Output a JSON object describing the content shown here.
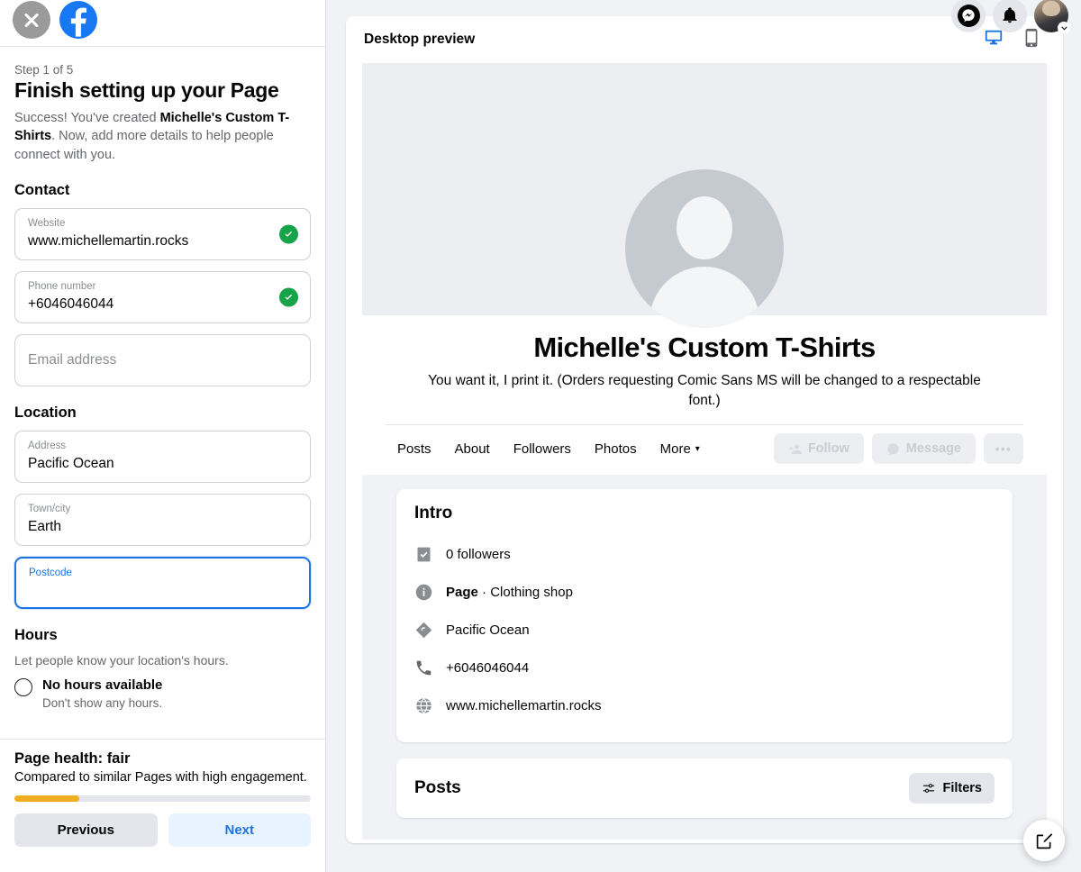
{
  "sidebar": {
    "close_icon": "close-icon",
    "brand_icon": "facebook-logo",
    "step_label": "Step 1 of 5",
    "title": "Finish setting up your Page",
    "desc_part1": "Success! You've created ",
    "desc_bold": "Michelle's Custom T-Shirts",
    "desc_part2": ". Now, add more details to help people connect with you.",
    "contact_heading": "Contact",
    "location_heading": "Location",
    "fields": {
      "website": {
        "label": "Website",
        "value": "www.michellemartin.rocks",
        "valid": true
      },
      "phone": {
        "label": "Phone number",
        "value": "+6046046044",
        "valid": true
      },
      "email": {
        "placeholder": "Email address",
        "value": ""
      },
      "address": {
        "label": "Address",
        "value": "Pacific Ocean"
      },
      "city": {
        "label": "Town/city",
        "value": "Earth"
      },
      "postcode": {
        "label": "Postcode",
        "value": "",
        "focused": true
      }
    },
    "hours": {
      "heading": "Hours",
      "subtitle": "Let people know your location's hours.",
      "option_label": "No hours available",
      "option_sub": "Don't show any hours."
    },
    "health": {
      "title": "Page health: fair",
      "desc": "Compared to similar Pages with high engagement.",
      "progress_percent": 22,
      "bar_color": "#f0ad1f"
    },
    "buttons": {
      "previous": "Previous",
      "next": "Next"
    }
  },
  "topbar": {
    "messenger_icon": "messenger-icon",
    "notifications_icon": "bell-icon",
    "account_icon": "user-avatar"
  },
  "preview": {
    "header_title": "Desktop preview",
    "device_desktop": "desktop-monitor-icon",
    "device_mobile": "mobile-phone-icon",
    "active_device": "desktop",
    "active_color": "#1b74e4",
    "page_name": "Michelle's Custom T-Shirts",
    "tagline": "You want it, I print it. (Orders requesting Comic Sans MS will be changed to a respectable font.)",
    "tabs": [
      {
        "label": "Posts"
      },
      {
        "label": "About"
      },
      {
        "label": "Followers"
      },
      {
        "label": "Photos"
      },
      {
        "label": "More",
        "caret": "▾"
      }
    ],
    "actions": {
      "follow": "Follow",
      "message": "Message",
      "more": "•••"
    },
    "intro": {
      "title": "Intro",
      "rows": [
        {
          "icon": "followers-badge-icon",
          "text": "0 followers",
          "bold": ""
        },
        {
          "icon": "info-circle-icon",
          "bold": "Page",
          "text": " · Clothing shop"
        },
        {
          "icon": "location-pin-icon",
          "text": "Pacific Ocean",
          "bold": ""
        },
        {
          "icon": "phone-icon",
          "text": "+6046046044",
          "bold": ""
        },
        {
          "icon": "globe-icon",
          "text": "www.michellemartin.rocks",
          "bold": ""
        }
      ]
    },
    "posts": {
      "title": "Posts",
      "filters_label": "Filters",
      "filters_icon": "sliders-icon"
    },
    "fab_icon": "compose-icon"
  }
}
